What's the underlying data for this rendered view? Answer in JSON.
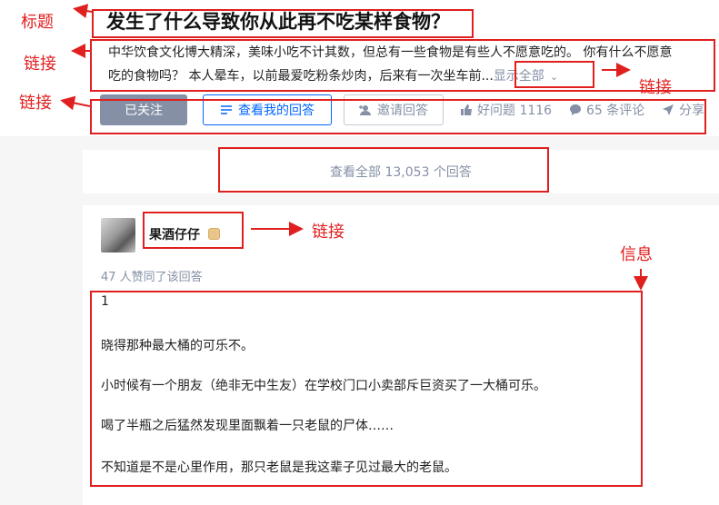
{
  "question": {
    "title": "发生了什么导致你从此再不吃某样食物？",
    "detail_line1": "中华饮食文化博大精深，美味小吃不计其数，但总有一些食物是有些人不愿意吃的。 你有什么不愿意",
    "detail_line2": "吃的食物吗？ 本人晕车，以前最爱吃粉条炒肉，后来有一次坐车前...",
    "show_all_label": "显示全部",
    "follow_label": "已关注",
    "view_my_answer_label": "查看我的回答",
    "invite_label": "邀请回答",
    "good_question_label": "好问题 1116",
    "comments_label": "65 条评论",
    "share_label": "分享"
  },
  "view_all_label": "查看全部 13,053 个回答",
  "answer": {
    "author_name": "果酒仔仔",
    "voters_text": "47 人赞同了该回答",
    "paragraphs": [
      "1",
      "晓得那种最大桶的可乐不。",
      "小时候有一个朋友（绝非无中生友）在学校门口小卖部斥巨资买了一大桶可乐。",
      "喝了半瓶之后猛然发现里面飘着一只老鼠的尸体……",
      "不知道是不是心里作用，那只老鼠是我这辈子见过最大的老鼠。"
    ]
  },
  "annotations": {
    "title_label": "标题",
    "link_label_1": "链接",
    "link_label_2": "链接",
    "link_label_3": "链接",
    "link_label_4": "链接",
    "info_label": "信息"
  },
  "colors": {
    "annotation_red": "#e0201f",
    "zhihu_blue": "#0066ff",
    "muted_gray": "#8590a6"
  }
}
